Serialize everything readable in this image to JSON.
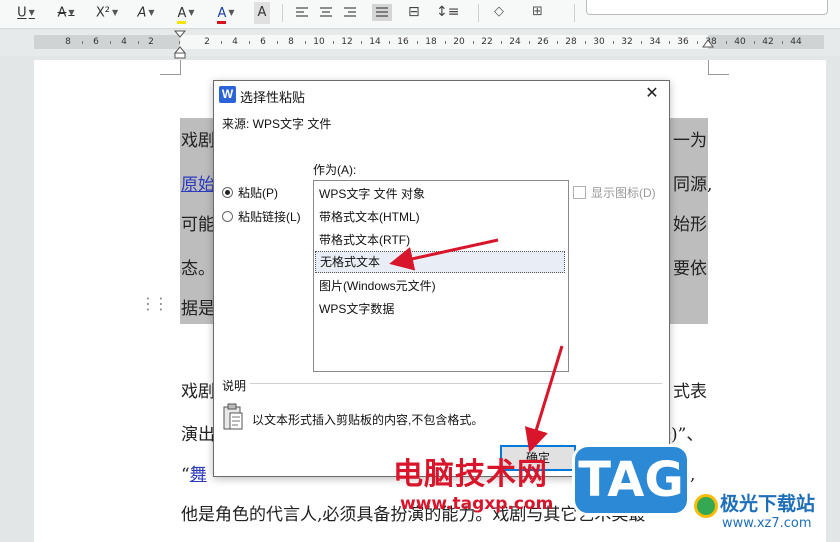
{
  "toolbar": {
    "underline": "U",
    "strike": "A",
    "superscript": "X²",
    "text_effect": "A",
    "highlight": "A",
    "font_color": "A",
    "char_shading": "A",
    "highlight_color": "#f5e400",
    "font_color_value": "#d6141f"
  },
  "ruler": {
    "ticks": [
      "8",
      "6",
      "4",
      "2",
      "2",
      "4",
      "6",
      "8",
      "10",
      "12",
      "14",
      "16",
      "18",
      "20",
      "22",
      "24",
      "26",
      "28",
      "30",
      "32",
      "34",
      "36",
      "38",
      "40",
      "42",
      "44"
    ]
  },
  "document": {
    "p1": {
      "l1_start": "戏剧",
      "l1_end": "一为",
      "l2_start": "原始",
      "l2_end": "同源,",
      "l3_start": "可能",
      "l3_end": "始形",
      "l4_start": "态。",
      "l4_end": "要依",
      "l5_start": "据是"
    },
    "p2": {
      "l1_start": "戏剧",
      "l1_end": "式表",
      "l2_start": "演出",
      "l2_end": "舞)”、",
      "l3_quote": "“",
      "l3_link": "舞",
      "l3_end": "素,",
      "l4": "他是角色的代言人,必须具备扮演的能力。戏剧与其它艺术类最"
    }
  },
  "dialog": {
    "icon": "W",
    "title": "选择性粘贴",
    "source": "来源: WPS文字 文件",
    "as_label": "作为(A):",
    "radio_paste": "粘贴(P)",
    "radio_link": "粘贴链接(L)",
    "items": [
      "WPS文字 文件 对象",
      "带格式文本(HTML)",
      "带格式文本(RTF)",
      "无格式文本",
      "图片(Windows元文件)",
      "WPS文字数据"
    ],
    "show_icon": "显示图标(D)",
    "desc_label": "说明",
    "desc_text": "以文本形式插入剪贴板的内容,不包含格式。",
    "ok": "确定",
    "cancel": "取消"
  },
  "watermark": {
    "site_cn": "电脑技术网",
    "url": "www.tagxp.com",
    "tag": "TAG",
    "brand": "极光下载站",
    "brand_url": "www.xz7.com"
  },
  "colors": {
    "arrow": "#d8152a",
    "accent": "#0078d7"
  }
}
